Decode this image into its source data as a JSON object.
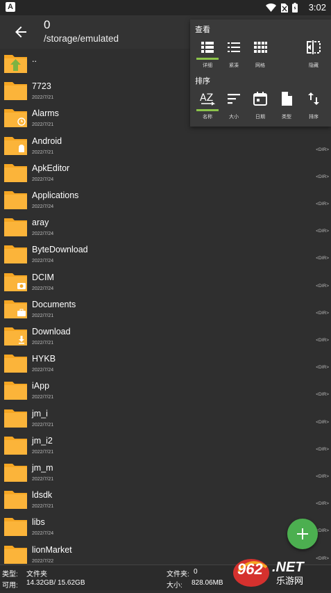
{
  "status_bar": {
    "app_badge": "A",
    "time": "3:02"
  },
  "appbar": {
    "count": "0",
    "path": "/storage/emulated"
  },
  "view_popup": {
    "view_header": "查看",
    "view_options": [
      "详细",
      "紧凑",
      "网格",
      "隐藏"
    ],
    "sort_header": "排序",
    "sort_options": [
      "名称",
      "大小",
      "日期",
      "类型",
      "排序"
    ],
    "accent_color": "#8bc34a"
  },
  "files": [
    {
      "name": "..",
      "date": "",
      "tag": ""
    },
    {
      "name": "7723",
      "date": "2022/7/21",
      "tag": ""
    },
    {
      "name": "Alarms",
      "date": "2022/7/21",
      "tag": ""
    },
    {
      "name": "Android",
      "date": "2022/7/21",
      "tag": "<DIR>"
    },
    {
      "name": "ApkEditor",
      "date": "2022/7/24",
      "tag": "<DIR>"
    },
    {
      "name": "Applications",
      "date": "2022/7/24",
      "tag": "<DIR>"
    },
    {
      "name": "aray",
      "date": "2022/7/24",
      "tag": "<DIR>"
    },
    {
      "name": "ByteDownload",
      "date": "2022/7/24",
      "tag": "<DIR>"
    },
    {
      "name": "DCIM",
      "date": "2022/7/24",
      "tag": "<DIR>"
    },
    {
      "name": "Documents",
      "date": "2022/7/21",
      "tag": "<DIR>"
    },
    {
      "name": "Download",
      "date": "2022/7/21",
      "tag": "<DIR>"
    },
    {
      "name": "HYKB",
      "date": "2022/7/24",
      "tag": "<DIR>"
    },
    {
      "name": "iApp",
      "date": "2022/7/21",
      "tag": "<DIR>"
    },
    {
      "name": "jm_i",
      "date": "2022/7/21",
      "tag": "<DIR>"
    },
    {
      "name": "jm_i2",
      "date": "2022/7/21",
      "tag": "<DIR>"
    },
    {
      "name": "jm_m",
      "date": "2022/7/21",
      "tag": "<DIR>"
    },
    {
      "name": "ldsdk",
      "date": "2022/7/21",
      "tag": "<DIR>"
    },
    {
      "name": "libs",
      "date": "2022/7/24",
      "tag": "<DIR>"
    },
    {
      "name": "lionMarket",
      "date": "2022/7/22",
      "tag": "<DIR>"
    }
  ],
  "footer": {
    "type_label": "类型:",
    "type_value": "文件夹",
    "avail_label": "可用:",
    "avail_value": "14.32GB/ 15.62GB",
    "folders_label": "文件夹:",
    "folders_value": "0",
    "size_label": "大小:",
    "size_value": "828.06MB"
  },
  "watermark": {
    "text": "962.NET",
    "subtext": "乐游网"
  },
  "colors": {
    "folder": "#f5a623",
    "fab": "#4caf50",
    "background": "#2f2f2f"
  }
}
